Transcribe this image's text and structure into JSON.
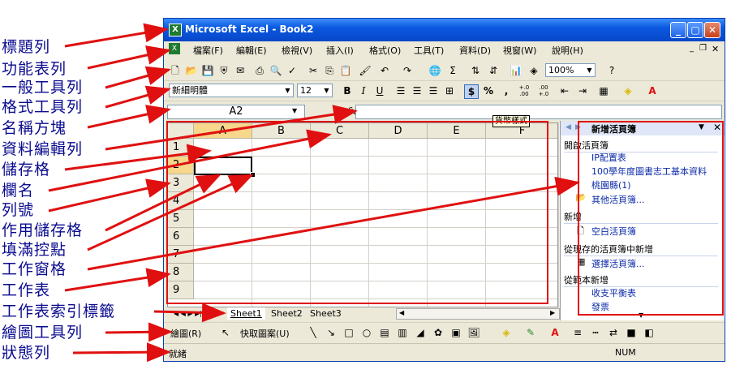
{
  "window": {
    "title": "Microsoft Excel - Book2",
    "app_icon": "X"
  },
  "menu": [
    "檔案(F)",
    "編輯(E)",
    "檢視(V)",
    "插入(I)",
    "格式(O)",
    "工具(T)",
    "資料(D)",
    "視窗(W)",
    "說明(H)"
  ],
  "standard_toolbar": {
    "zoom": "100%",
    "help_label": "?"
  },
  "format_toolbar": {
    "font": "新細明體",
    "size": "12",
    "bold": "B",
    "italic": "I",
    "underline": "U",
    "currency": "$",
    "percent": "%",
    "comma": ",",
    "inc_decimal": "+.0 .00",
    "dec_decimal": ".00 +.0"
  },
  "formula_bar": {
    "name_box": "A2",
    "fx": "fx",
    "tooltip": "貨幣樣式"
  },
  "grid": {
    "columns": [
      "A",
      "B",
      "C",
      "D",
      "E",
      "F"
    ],
    "rows": [
      "1",
      "2",
      "3",
      "4",
      "5",
      "6",
      "7",
      "8",
      "9"
    ],
    "active_cell": "A2"
  },
  "sheets": [
    "Sheet1",
    "Sheet2",
    "Sheet3"
  ],
  "task_pane": {
    "title": "新增活頁簿",
    "open_section": "開啟活頁簿",
    "open_items": [
      "IP配置表",
      "100學年度圖書志工基本資料",
      "桃園縣(1)",
      "其他活頁簿..."
    ],
    "new_section": "新增",
    "new_items": [
      "空白活頁簿"
    ],
    "existing_section": "從現存的活頁簿中新增",
    "existing_items": [
      "選擇活頁簿..."
    ],
    "template_section": "從範本新增",
    "template_items": [
      "收支平衡表",
      "發票"
    ]
  },
  "drawing_toolbar": {
    "draw": "繪圖(R)",
    "autoshapes": "快取圖案(U)"
  },
  "status_bar": {
    "ready": "就緒",
    "num": "NUM"
  },
  "annotations": [
    "標題列",
    "功能表列",
    "一般工具列",
    "格式工具列",
    "名稱方塊",
    "資料編輯列",
    "儲存格",
    "欄名",
    "列號",
    "作用儲存格",
    "填滿控點",
    "工作窗格",
    "工作表",
    "工作表索引標籤",
    "繪圖工具列",
    "狀態列"
  ],
  "colors": {
    "arrow": "#e01010",
    "label": "#0b0b8f",
    "title_bar": "#0a58e0"
  }
}
